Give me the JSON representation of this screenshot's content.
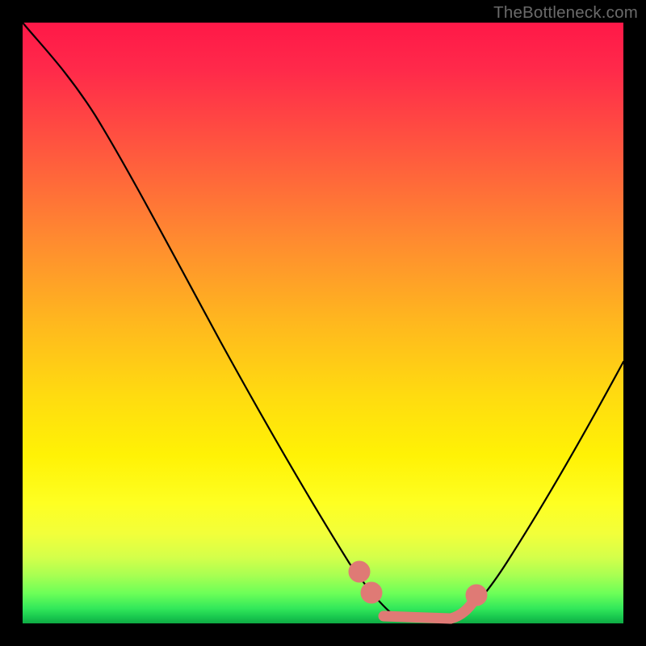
{
  "watermark": "TheBottleneck.com",
  "chart_data": {
    "type": "line",
    "title": "",
    "xlabel": "",
    "ylabel": "",
    "xlim": [
      0,
      100
    ],
    "ylim": [
      0,
      100
    ],
    "background_gradient": {
      "top": "#ff1848",
      "mid": "#ffdb10",
      "bottom": "#18c74e"
    },
    "series": [
      {
        "name": "bottleneck-curve",
        "color": "#000000",
        "width": 2,
        "x": [
          0,
          5,
          10,
          15,
          20,
          25,
          30,
          35,
          40,
          45,
          50,
          55,
          58,
          60,
          62,
          65,
          68,
          70,
          73,
          76,
          80,
          85,
          90,
          95,
          100
        ],
        "y": [
          100,
          95,
          89,
          82,
          74,
          66,
          57,
          48,
          39,
          30,
          21,
          12,
          7,
          4,
          2,
          1,
          1,
          1,
          2,
          4,
          8,
          15,
          24,
          35,
          47
        ]
      },
      {
        "name": "sweet-spot-highlight",
        "color": "#e07a74",
        "type": "scatter",
        "marker_size": 10,
        "x": [
          56,
          58,
          60,
          62,
          64,
          66,
          68,
          70,
          72,
          73
        ],
        "y": [
          10,
          6,
          3,
          1,
          1,
          1,
          1,
          1,
          3,
          4
        ]
      }
    ],
    "flat_region": {
      "x_start": 60,
      "x_end": 70,
      "y": 1
    },
    "grid": false,
    "legend": false
  }
}
